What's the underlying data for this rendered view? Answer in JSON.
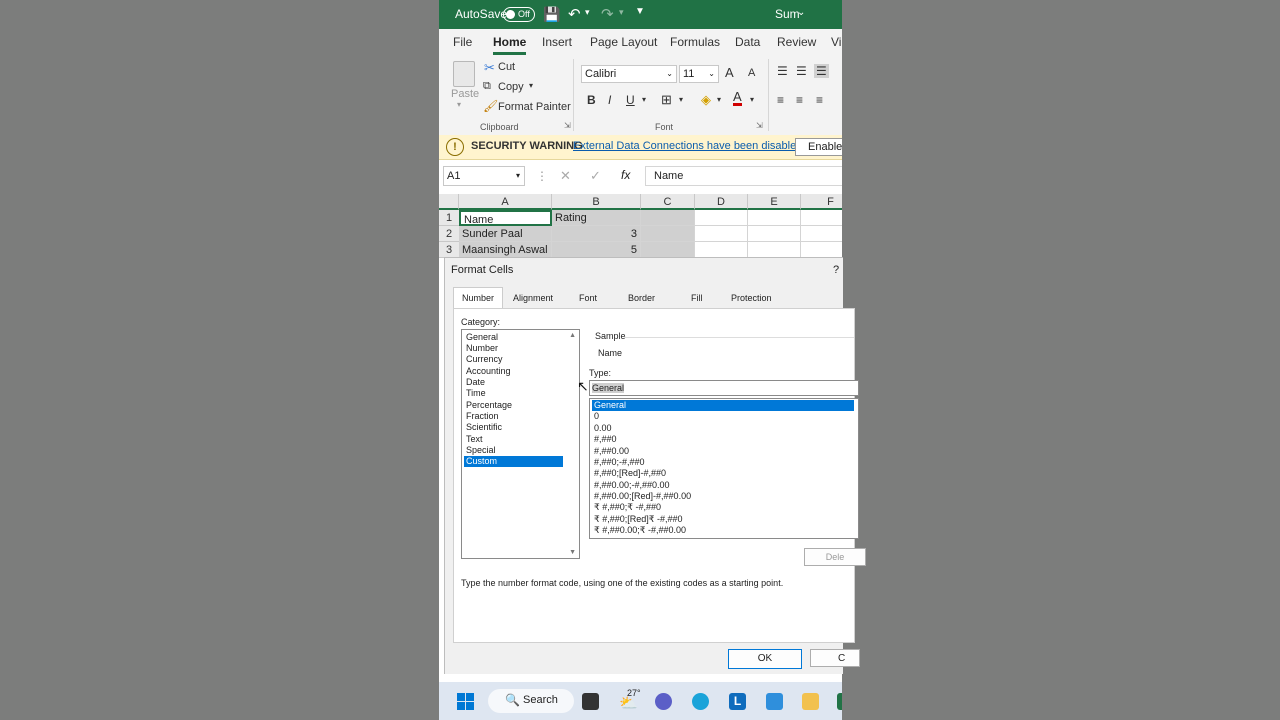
{
  "titlebar": {
    "autosave": "AutoSave",
    "toggle": "Off",
    "sum": "Sum"
  },
  "tabs": [
    "File",
    "Home",
    "Insert",
    "Page Layout",
    "Formulas",
    "Data",
    "Review",
    "Vi"
  ],
  "clipboard": {
    "paste": "Paste",
    "cut": "Cut",
    "copy": "Copy",
    "format_painter": "Format Painter",
    "group": "Clipboard"
  },
  "font": {
    "name": "Calibri",
    "size": "11",
    "group": "Font",
    "bold": "B",
    "italic": "I",
    "underline": "U",
    "grow": "A",
    "shrink": "A"
  },
  "security": {
    "label": "SECURITY WARNING",
    "message": "External Data Connections have been disabled",
    "button": "Enable C"
  },
  "formula_bar": {
    "name_box": "A1",
    "fx": "fx",
    "content": "Name"
  },
  "grid": {
    "columns": [
      "A",
      "B",
      "C",
      "D",
      "E",
      "F"
    ],
    "rows": [
      {
        "num": "1",
        "a": "Name",
        "b": "Rating"
      },
      {
        "num": "2",
        "a": "Sunder Paal",
        "b": "3"
      },
      {
        "num": "3",
        "a": "Maansingh Aswal",
        "b": "5"
      }
    ]
  },
  "dialog": {
    "title": "Format Cells",
    "help": "?",
    "tabs": [
      "Number",
      "Alignment",
      "Font",
      "Border",
      "Fill",
      "Protection"
    ],
    "category_label": "Category:",
    "categories": [
      "General",
      "Number",
      "Currency",
      "Accounting",
      "Date",
      "Time",
      "Percentage",
      "Fraction",
      "Scientific",
      "Text",
      "Special",
      "Custom"
    ],
    "selected_category": "Custom",
    "sample_label": "Sample",
    "sample_value": "Name",
    "type_label": "Type:",
    "type_value": "General",
    "formats": [
      "General",
      "0",
      "0.00",
      "#,##0",
      "#,##0.00",
      "#,##0;-#,##0",
      "#,##0;[Red]-#,##0",
      "#,##0.00;-#,##0.00",
      "#,##0.00;[Red]-#,##0.00",
      "₹ #,##0;₹ -#,##0",
      "₹ #,##0;[Red]₹ -#,##0",
      "₹ #,##0.00;₹ -#,##0.00"
    ],
    "delete_button": "Dele",
    "hint": "Type the number format code, using one of the existing codes as a starting point.",
    "ok": "OK",
    "cancel": "C"
  },
  "taskbar": {
    "search": "Search",
    "weather": "27°"
  },
  "colors": {
    "excel_green": "#217346",
    "title_green": "#207245",
    "selection_blue": "#0078d7",
    "warning_bg": "#fff4ce"
  }
}
